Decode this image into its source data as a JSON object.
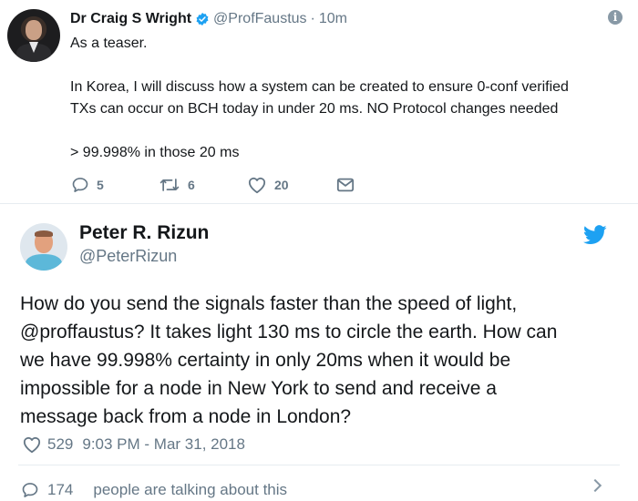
{
  "tweet1": {
    "author_name": "Dr Craig S Wright",
    "handle": "@ProfFaustus",
    "separator": "·",
    "time": "10m",
    "lines": [
      "As a teaser.",
      "In Korea, I will discuss how a system can be created to ensure 0-conf verified",
      "TXs can occur on BCH today in under 20 ms. NO Protocol changes needed",
      "> 99.998% in those 20 ms"
    ],
    "actions": {
      "replies": "5",
      "retweets": "6",
      "likes": "20"
    },
    "icons": [
      "verified-badge-icon",
      "info-icon",
      "reply-icon",
      "retweet-icon",
      "like-icon",
      "direct-message-icon"
    ],
    "colors": {
      "verified": "#1da1f2",
      "secondary_text": "#657786"
    }
  },
  "tweet2": {
    "author_name": "Peter R. Rizun",
    "handle": "@PeterRizun",
    "text_lines": [
      "How do you send the signals faster than the speed of light,",
      "@proffaustus? It takes light 130 ms to circle the earth.  How can",
      "we have 99.998% certainty in only 20ms when it would be",
      "impossible for a node in New York to send and receive a",
      "message back from a node in London?"
    ],
    "likes": "529",
    "timestamp": "9:03 PM - Mar 31, 2018",
    "icons": [
      "twitter-bird-icon",
      "like-icon"
    ],
    "colors": {
      "bird": "#1da1f2"
    }
  },
  "cutoff_row": {
    "count": "174",
    "text": "people are talking about this"
  }
}
